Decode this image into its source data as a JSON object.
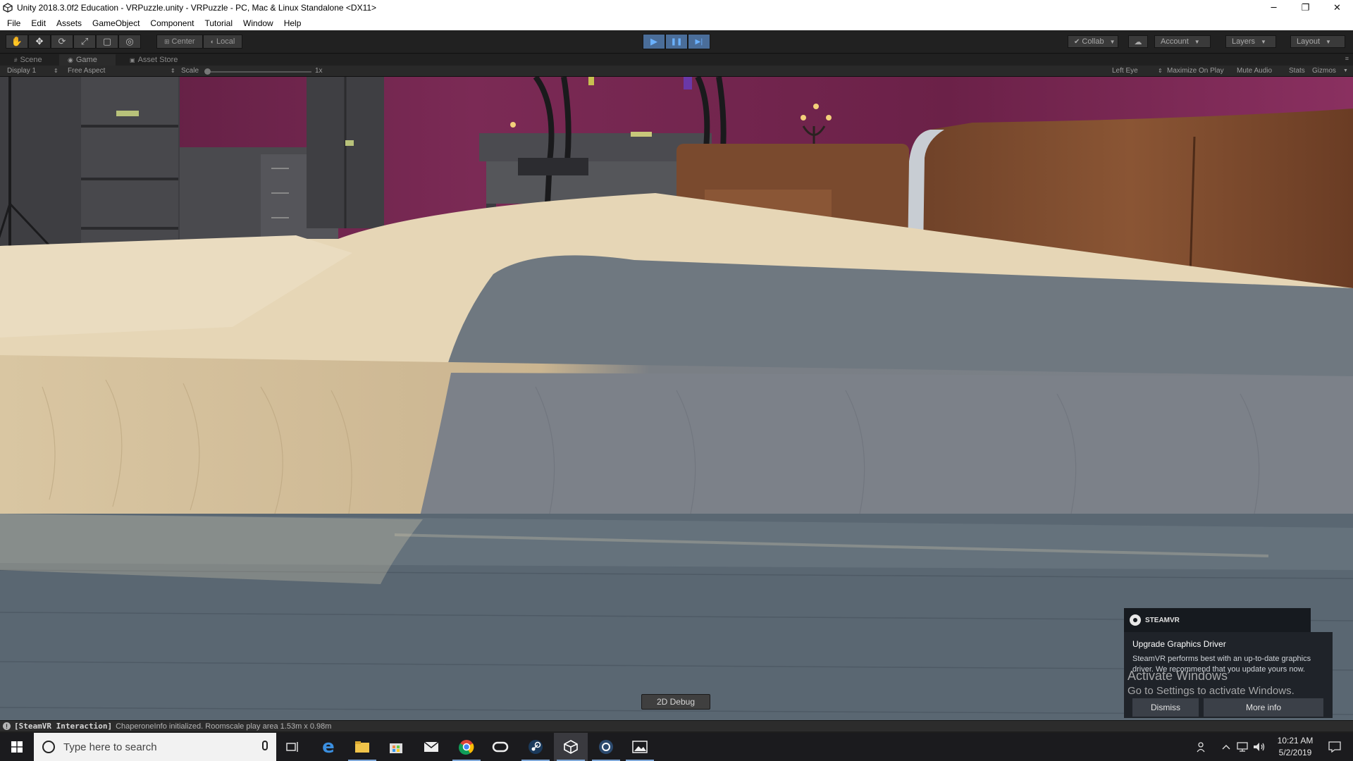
{
  "window": {
    "title": "Unity 2018.3.0f2 Education - VRPuzzle.unity - VRPuzzle - PC, Mac & Linux Standalone <DX11>",
    "minimize": "─",
    "restore": "❐",
    "close": "✕"
  },
  "menu": [
    "File",
    "Edit",
    "Assets",
    "GameObject",
    "Component",
    "Tutorial",
    "Window",
    "Help"
  ],
  "toolbar": {
    "tools": [
      {
        "name": "hand-tool",
        "glyph": "✋"
      },
      {
        "name": "move-tool",
        "glyph": "✥"
      },
      {
        "name": "rotate-tool",
        "glyph": "⟳"
      },
      {
        "name": "scale-tool",
        "glyph": "⤢"
      },
      {
        "name": "rect-tool",
        "glyph": "▢"
      },
      {
        "name": "transform-tool",
        "glyph": "◎"
      }
    ],
    "pivot": "Center",
    "space": "Local",
    "play": "▶",
    "pause": "❚❚",
    "step": "▶|",
    "collab": "Collab",
    "account": "Account",
    "layers": "Layers",
    "layout": "Layout"
  },
  "tabs": [
    "Scene",
    "Game",
    "Asset Store"
  ],
  "game_options": {
    "display": "Display 1",
    "aspect": "Free Aspect",
    "scale_label": "Scale",
    "scale_value": "1x",
    "eye": "Left Eye",
    "maximize": "Maximize On Play",
    "mute": "Mute Audio",
    "stats": "Stats",
    "gizmos": "Gizmos"
  },
  "debug_button": "2D Debug",
  "steamvr": {
    "brand": "STEAMVR",
    "title": "Upgrade Graphics Driver",
    "message": "SteamVR performs best with an up-to-date graphics driver. We recommend that you update yours now.",
    "dismiss": "Dismiss",
    "more": "More info"
  },
  "watermark": {
    "line1": "Activate Windows",
    "line2": "Go to Settings to activate Windows."
  },
  "console": {
    "tag": "[SteamVR Interaction]",
    "message": "ChaperoneInfo initialized. Roomscale play area 1.53m x 0.98m"
  },
  "taskbar": {
    "search_placeholder": "Type here to search",
    "time": "10:21 AM",
    "date": "5/2/2019"
  },
  "colors": {
    "unity_dark": "#212121",
    "play_active": "#4a6d99",
    "wall": "#7a2450",
    "wood_floor": "#5b6670",
    "table_top": "#e8dcc4"
  }
}
